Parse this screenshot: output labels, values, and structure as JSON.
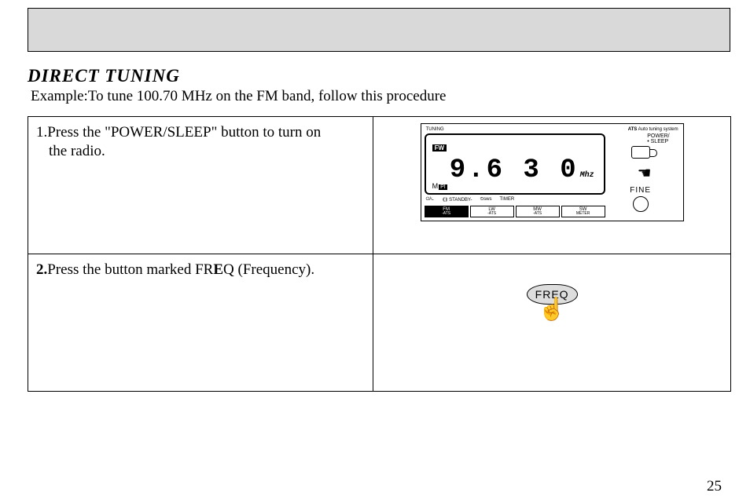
{
  "section_title": "DIRECT TUNING",
  "example_line": "Example:To tune 100.70 MHz on the FM band, follow this procedure",
  "steps": [
    {
      "num": "1.",
      "text_pre": "Press the  \"POWER/SLEEP\" button to turn on",
      "text_cont": "the radio."
    },
    {
      "num": "2.",
      "text_pre": "Press the button  marked FR",
      "bold": "E",
      "text_post": "Q (Frequency)."
    }
  ],
  "radio": {
    "top_left": "TUNING",
    "top_right_brand": "ATS",
    "top_right_text": " Auto tuning system",
    "fw_label": "FW",
    "freq": "9.6 3 0",
    "unit": "Mhz",
    "bottom_m": "M",
    "bottom_tag": "PI",
    "power_sleep": "POWER/\n• SLEEP",
    "fine": "FINE",
    "icons": [
      "⏻/⏾",
      "⟪⟫ STANDBY-",
      "⏲sws",
      "TIMER"
    ],
    "bands": [
      {
        "t": "FM",
        "s": "-ATS"
      },
      {
        "t": "LW",
        "s": "-ATS"
      },
      {
        "t": "MW",
        "s": "-ATS"
      },
      {
        "t": "SW",
        "s": "METER"
      }
    ]
  },
  "freq_button_label": "FREQ",
  "page_number": "25"
}
